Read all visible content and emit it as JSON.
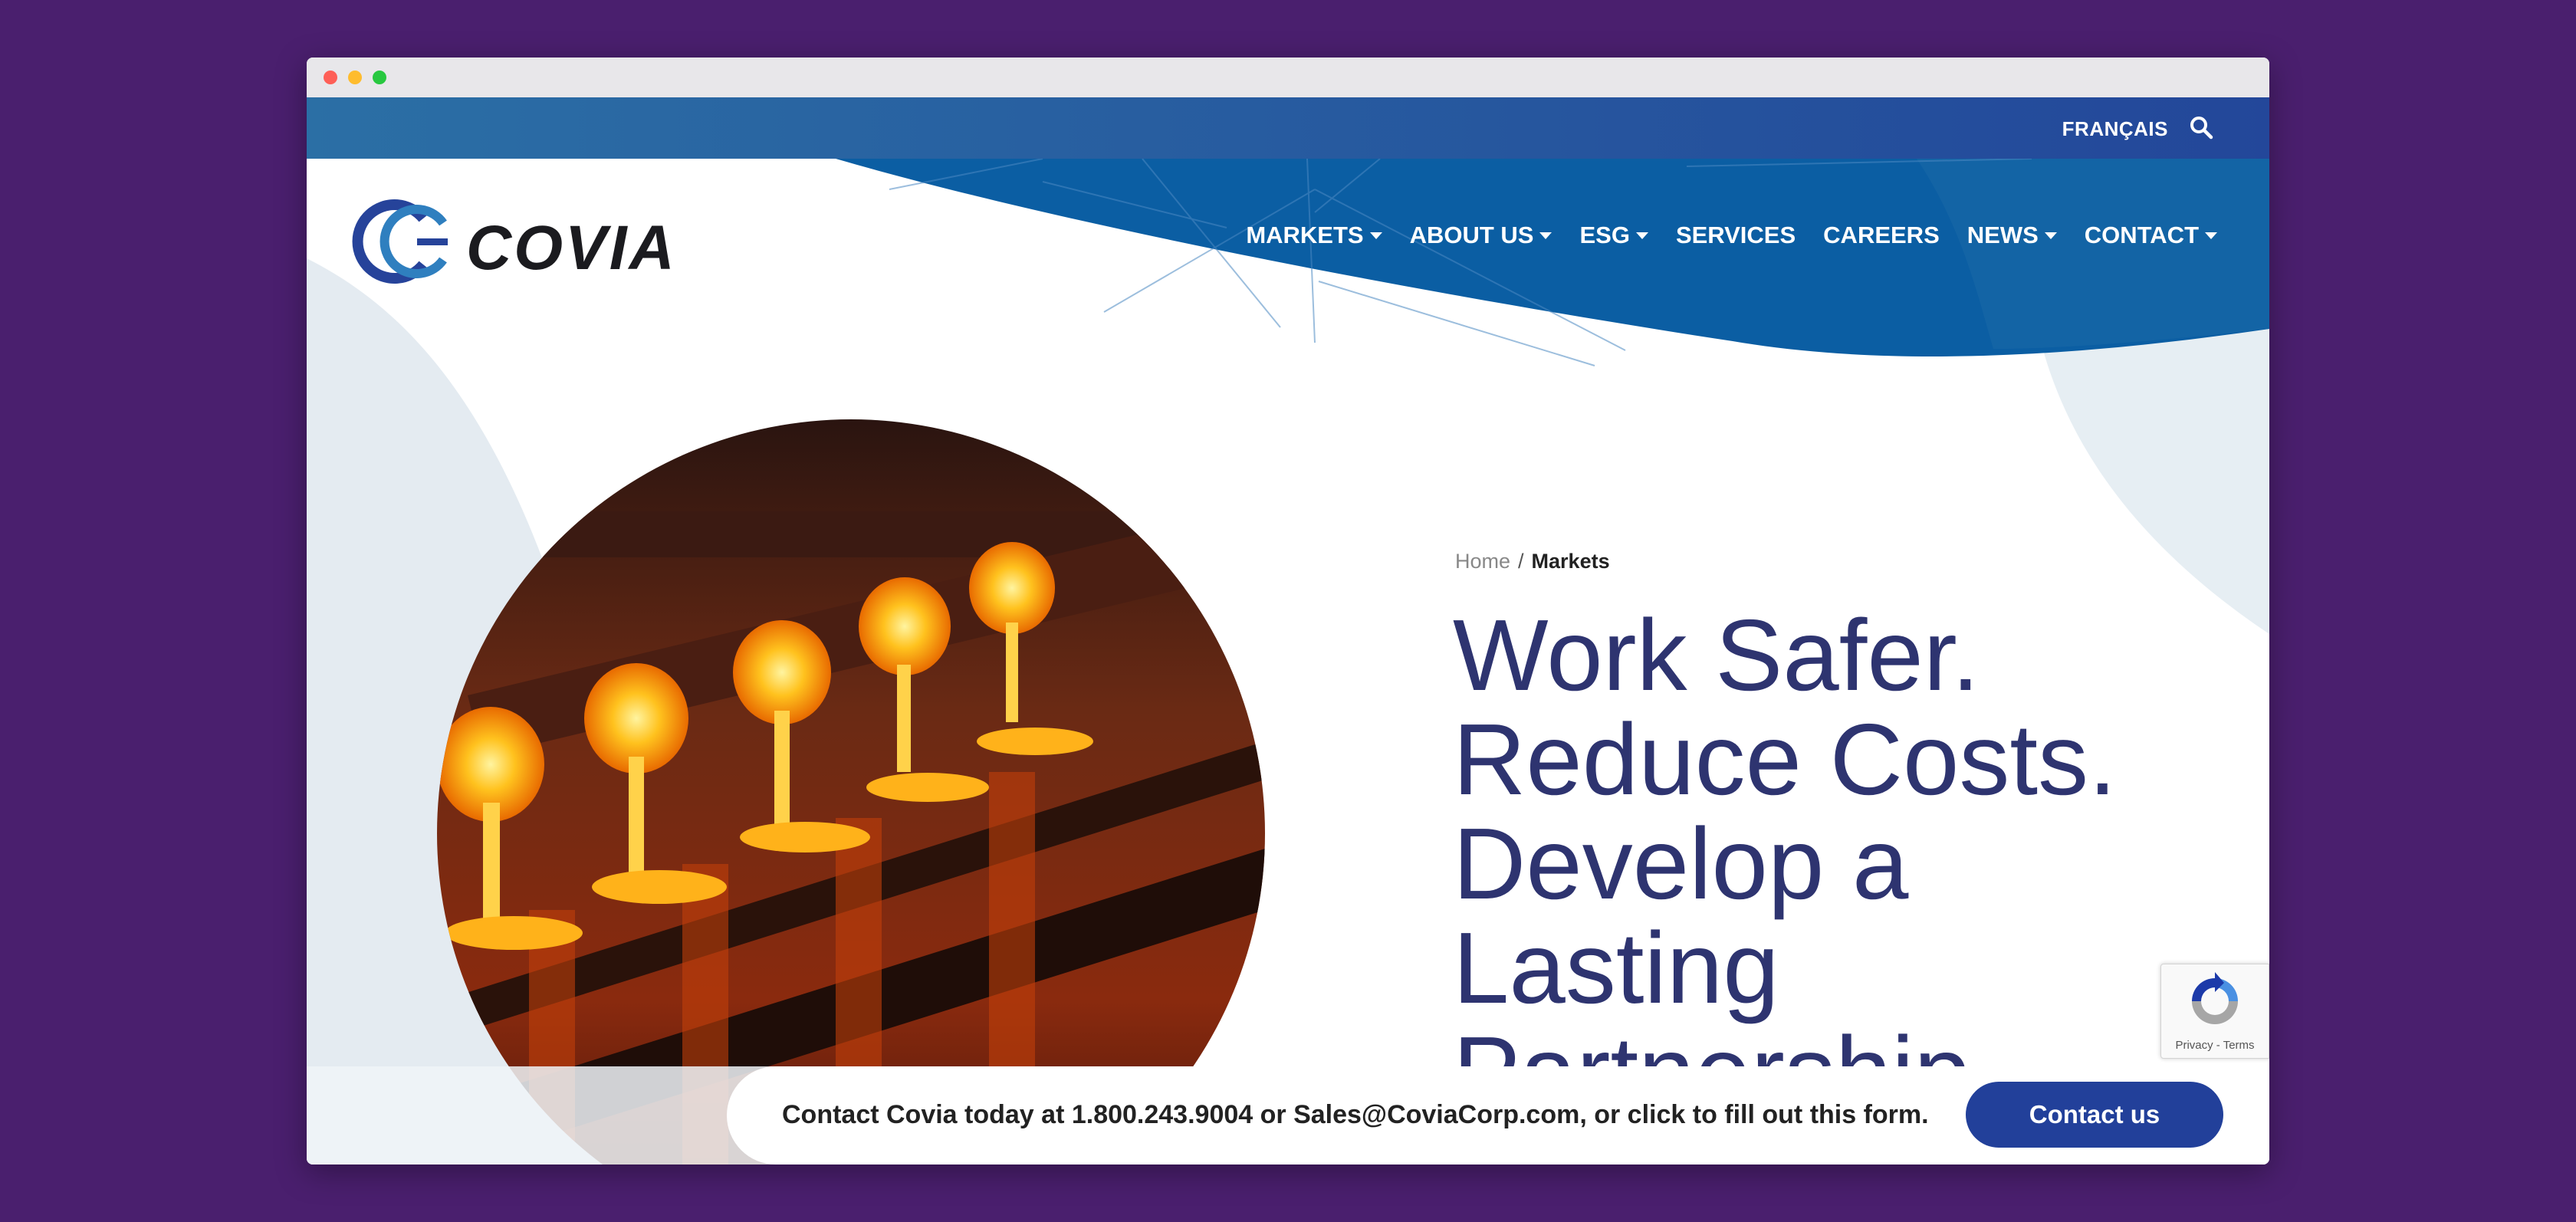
{
  "utility_bar": {
    "language_label": "FRANÇAIS",
    "search_icon": "search-icon"
  },
  "brand": {
    "logo_text": "COVIA"
  },
  "nav": {
    "markets": "MARKETS",
    "about_us": "ABOUT US",
    "esg": "ESG",
    "services": "SERVICES",
    "careers": "CAREERS",
    "news": "NEWS",
    "contact": "CONTACT"
  },
  "breadcrumb": {
    "home": "Home",
    "separator": "/",
    "current": "Markets"
  },
  "hero": {
    "title_line1": "Work Safer.",
    "title_line2": "Reduce Costs.",
    "title_line3": "Develop a",
    "title_line4": "Lasting",
    "title_line5": "Partnership."
  },
  "recaptcha": {
    "privacy": "Privacy",
    "separator": "-",
    "terms": "Terms"
  },
  "contact_bar": {
    "message": "Contact Covia today at 1.800.243.9004 or Sales@CoviaCorp.com, or click to fill out this form.",
    "button_label": "Contact us"
  },
  "colors": {
    "page_background": "#4a1f6e",
    "brand_blue": "#0b5ea3",
    "title_navy": "#2e3470",
    "button_blue": "#22409a"
  }
}
